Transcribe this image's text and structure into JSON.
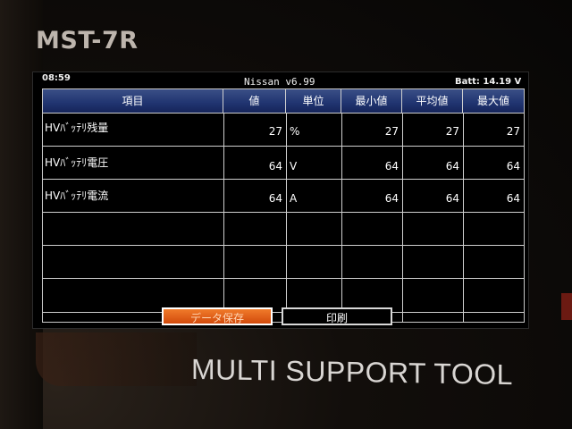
{
  "device": {
    "model": "MST-7R",
    "brand_banner": "MULTI SUPPORT TOOL"
  },
  "status": {
    "time": "08:59",
    "title": "Nissan v6.99",
    "battery": "Batt: 14.19 V"
  },
  "table": {
    "headers": [
      "項目",
      "値",
      "単位",
      "最小値",
      "平均値",
      "最大値"
    ],
    "rows": [
      {
        "name": "HVﾊﾞｯﾃﾘ残量",
        "value": "27",
        "unit": "%",
        "min": "27",
        "avg": "27",
        "max": "27"
      },
      {
        "name": "HVﾊﾞｯﾃﾘ電圧",
        "value": "64",
        "unit": "V",
        "min": "64",
        "avg": "64",
        "max": "64"
      },
      {
        "name": "HVﾊﾞｯﾃﾘ電流",
        "value": "64",
        "unit": "A",
        "min": "64",
        "avg": "64",
        "max": "64"
      }
    ]
  },
  "buttons": {
    "save": "データ保存",
    "print": "印刷"
  }
}
